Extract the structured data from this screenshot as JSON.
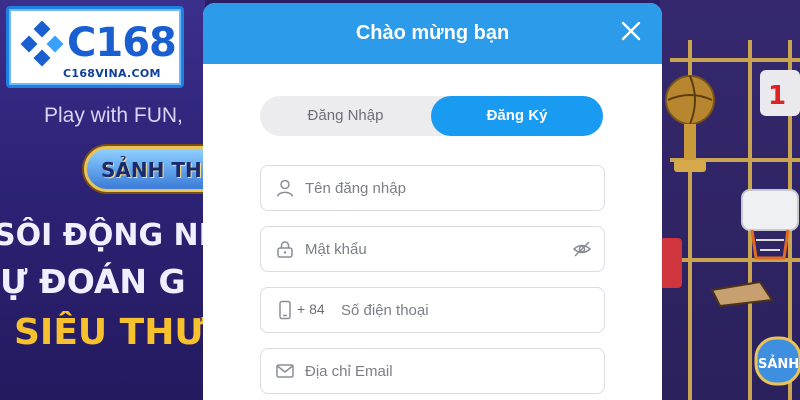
{
  "brand": {
    "logo_text": "C168",
    "logo_domain": "C168VINA.COM"
  },
  "background": {
    "tagline": "Play with FUN,",
    "hall_badge": "SẢNH THƯỞ",
    "promo_line1": "SÔI ĐỘNG NB",
    "promo_line2": "Ự ĐOÁN G",
    "promo_line3": "SIÊU THƯ"
  },
  "modal": {
    "title": "Chào mừng bạn",
    "tabs": [
      {
        "label": "Đăng Nhập",
        "active": false
      },
      {
        "label": "Đăng Ký",
        "active": true
      }
    ],
    "fields": {
      "username": {
        "placeholder": "Tên đăng nhập",
        "value": ""
      },
      "password": {
        "placeholder": "Mật khẩu",
        "value": ""
      },
      "phone": {
        "prefix": "+ 84",
        "placeholder": "Số điện thoại",
        "value": ""
      },
      "email": {
        "placeholder": "Địa chỉ Email",
        "value": ""
      }
    }
  },
  "colors": {
    "header": "#2b9bea",
    "active_tab": "#1a9bf2",
    "tab_track": "#ececef"
  },
  "icons": [
    "close-icon",
    "user-icon",
    "lock-icon",
    "eye-off-icon",
    "phone-icon",
    "mail-icon"
  ]
}
